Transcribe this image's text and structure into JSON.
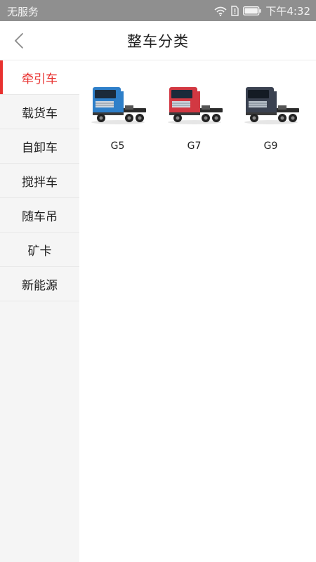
{
  "status_bar": {
    "carrier": "无服务",
    "time": "下午4:32",
    "icons": [
      "wifi-icon",
      "sim-alert-icon",
      "battery-icon"
    ]
  },
  "header": {
    "title": "整车分类",
    "back_icon": "chevron-left-icon"
  },
  "sidebar": {
    "active_index": 0,
    "accent_color": "#e8312f",
    "items": [
      {
        "label": "牵引车"
      },
      {
        "label": "载货车"
      },
      {
        "label": "自卸车"
      },
      {
        "label": "搅拌车"
      },
      {
        "label": "随车吊"
      },
      {
        "label": "矿卡"
      },
      {
        "label": "新能源"
      }
    ]
  },
  "products": [
    {
      "label": "G5",
      "color": "#2e7fc9"
    },
    {
      "label": "G7",
      "color": "#d23842"
    },
    {
      "label": "G9",
      "color": "#3a4150"
    }
  ]
}
